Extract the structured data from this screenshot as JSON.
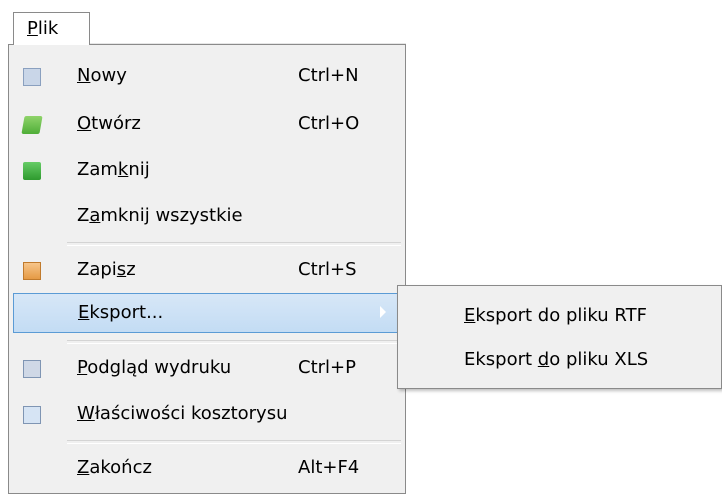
{
  "menubar": {
    "menu_title": "Plik"
  },
  "file_menu": {
    "items": [
      {
        "label": "Nowy",
        "shortcut": "Ctrl+N",
        "icon": "new-document-icon"
      },
      {
        "label": "Otwórz",
        "shortcut": "Ctrl+O",
        "icon": "open-folder-icon"
      },
      {
        "label": "Zamknij",
        "shortcut": "",
        "icon": "close-folder-icon"
      },
      {
        "label": "Zamknij wszystkie",
        "shortcut": "",
        "icon": ""
      },
      {
        "label": "Zapisz",
        "shortcut": "Ctrl+S",
        "icon": "save-icon"
      },
      {
        "label": "Eksport...",
        "shortcut": "",
        "icon": "",
        "has_submenu": true,
        "highlighted": true
      },
      {
        "label": "Podgląd wydruku",
        "shortcut": "Ctrl+P",
        "icon": "print-preview-icon"
      },
      {
        "label": "Właściwości kosztorysu",
        "shortcut": "",
        "icon": "properties-icon"
      },
      {
        "label": "Zakończ",
        "shortcut": "Alt+F4",
        "icon": ""
      }
    ]
  },
  "export_submenu": {
    "items": [
      {
        "label": "Eksport do pliku RTF"
      },
      {
        "label": "Eksport do pliku XLS"
      }
    ]
  },
  "colors": {
    "menu_background": "#f0f0f0",
    "highlight_border": "#5b9bd5",
    "highlight_fill": "#c8dff5"
  }
}
